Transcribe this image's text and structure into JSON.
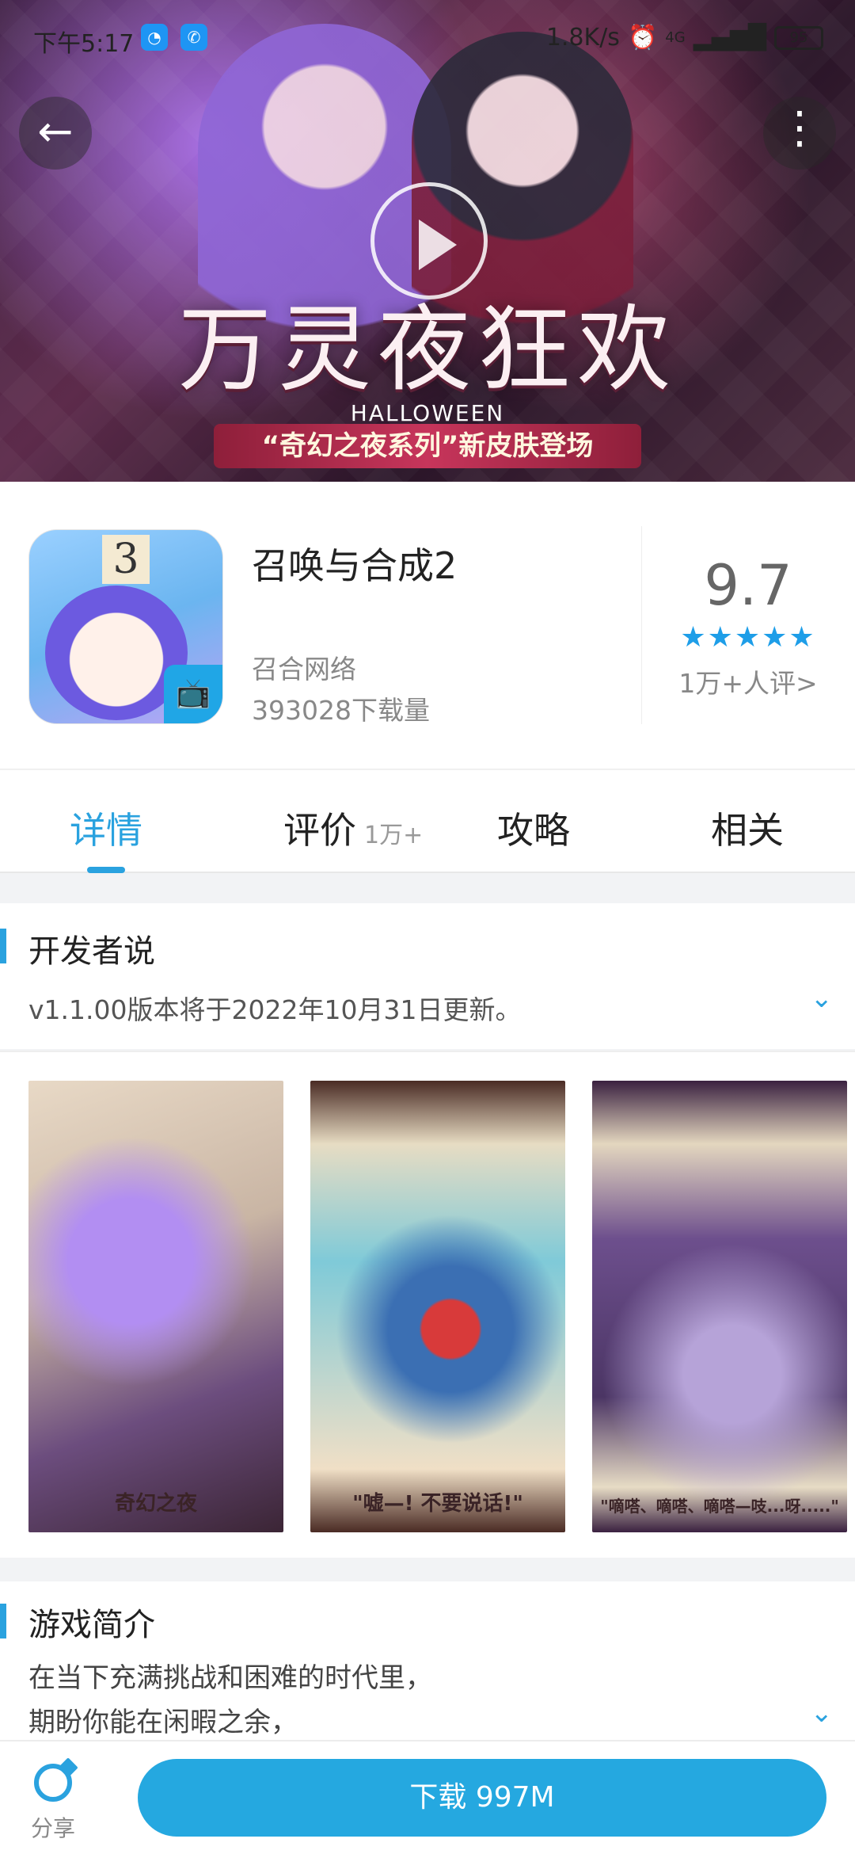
{
  "status_bar": {
    "time": "下午5:17",
    "network_speed": "1.8K/s",
    "network_type": "4G",
    "battery": "95"
  },
  "hero": {
    "title": "万灵夜狂欢",
    "subtitle": "HALLOWEEN",
    "ribbon": "“奇幻之夜系列”新皮肤登场",
    "back_icon": "arrow-left-icon",
    "more_icon": "more-vertical-icon",
    "play_icon": "play-icon"
  },
  "app": {
    "name": "召唤与合成2",
    "developer": "召合网络",
    "downloads": "393028下载量",
    "score": "9.7",
    "stars": "★★★★★",
    "rating_count": "1万+人评>",
    "icon_badge": "3"
  },
  "tabs": [
    {
      "label": "详情",
      "badge": ""
    },
    {
      "label": "评价",
      "badge": "1万+"
    },
    {
      "label": "攻略",
      "badge": ""
    },
    {
      "label": "相关",
      "badge": ""
    }
  ],
  "developer_section": {
    "title": "开发者说",
    "text": "v1.1.00版本将于2022年10月31日更新。"
  },
  "screenshots": {
    "captions": [
      "奇幻之夜",
      "\"嘘—! 不要说话!\"",
      "\"嘀嗒、嘀嗒、嘀嗒—吱...呀.....\""
    ]
  },
  "intro_section": {
    "title": "游戏简介",
    "lines": [
      "在当下充满挑战和困难的时代里，",
      "期盼你能在闲暇之余，"
    ]
  },
  "bottom_bar": {
    "share_label": "分享",
    "download_label": "下载 997M"
  },
  "colors": {
    "accent": "#2aa2df",
    "download_button": "#25a8e0"
  }
}
